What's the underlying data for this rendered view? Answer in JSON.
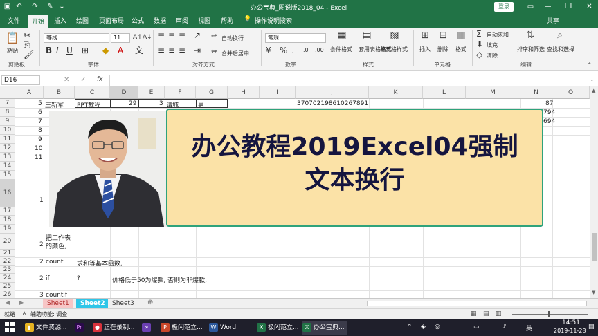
{
  "window": {
    "title": "办公宝典_图说版2018_04  -  Excel",
    "login_label": "登录",
    "colors": {
      "brand": "#217346",
      "overlay_bg": "#fbe2a7",
      "overlay_border": "#2fa37b"
    }
  },
  "ribbon_tabs": [
    "文件",
    "开始",
    "插入",
    "绘图",
    "页面布局",
    "公式",
    "数据",
    "审阅",
    "视图",
    "帮助"
  ],
  "ribbon_search": "操作说明搜索",
  "share_label": "共享",
  "ribbon": {
    "paste": "粘贴",
    "font_name": "等线",
    "font_size": "11",
    "wrap_text": "自动换行",
    "merge_center": "合并后居中",
    "number_format": "常规",
    "conditional_format": "条件格式",
    "table_format": "套用表格格式",
    "cell_style": "单元格样式",
    "insert": "插入",
    "delete": "删除",
    "format": "格式",
    "autosum": "自动求和",
    "fill": "填充",
    "clear": "清除",
    "sort_filter": "排序和筛选",
    "find_select": "查找和选择",
    "groups": [
      "剪贴板",
      "字体",
      "对齐方式",
      "数字",
      "样式",
      "单元格",
      "编辑"
    ]
  },
  "formula_bar": {
    "name_box": "D16",
    "fx": "fx",
    "value": ""
  },
  "columns": [
    "A",
    "B",
    "C",
    "D",
    "E",
    "F",
    "G",
    "H",
    "I",
    "J",
    "K",
    "L",
    "M",
    "N",
    "O"
  ],
  "rows": [
    "7",
    "8",
    "9",
    "10",
    "11",
    "12",
    "13",
    "14",
    "15",
    "16",
    "17",
    "18",
    "19",
    "20",
    "21",
    "22",
    "23",
    "24",
    "25",
    "26"
  ],
  "cells": {
    "a7": "5",
    "b7": "王新军",
    "c7": "PPT教程",
    "d7": "29",
    "e7": "3",
    "f7": "请城",
    "g7": "男",
    "j7": "370702198610267891",
    "n7": "87",
    "a8": "6",
    "n8": "794",
    "a9": "7",
    "n9": "694",
    "a10": "8",
    "a11": "9",
    "a12": "10",
    "a13": "11",
    "a16": "1",
    "a20": "2",
    "b20_line1": "把工作表",
    "b20_line2": "的颜色,",
    "a22": "2",
    "b22": "count",
    "c22": "求和等基本函数,",
    "a24": "2",
    "b24": "if",
    "c24": "?",
    "d24": "价格低于50为爆款, 否则为非爆款,",
    "a26": "3",
    "b26": "countif"
  },
  "sheets": [
    "Sheet1",
    "Sheet2",
    "Sheet3"
  ],
  "status": {
    "mode": "就绪",
    "accessibility": "辅助功能: 调查"
  },
  "overlay": {
    "title": "办公教程2019Excel04强制文本换行"
  },
  "taskbar": {
    "items": [
      "文件资源...",
      "正在录制...",
      "极闪范立...",
      "Word",
      "极闪范立...",
      "办公宝典..."
    ],
    "ime": "英",
    "time": "14:51",
    "date": "2019-11-28"
  }
}
